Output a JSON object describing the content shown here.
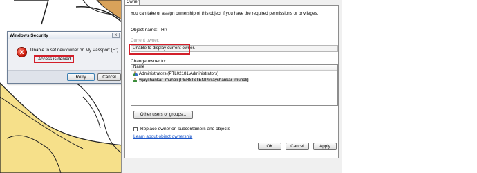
{
  "security_dialog": {
    "title": "Windows Security",
    "close_glyph": "x",
    "error_icon_glyph": "x",
    "message": "Unable to set new owner on My Passport (H:).",
    "detail": "Access is denied.",
    "retry_label": "Retry",
    "cancel_label": "Cancel",
    "icon": "error-icon"
  },
  "owner_dialog": {
    "tab_label": "Owner",
    "intro": "You can take or assign ownership of this object if you have the required permissions or privileges.",
    "object_name_label": "Object name:",
    "object_name_value": "H:\\",
    "current_owner_label": "Current owner:",
    "current_owner_value": "Unable to display current owner.",
    "change_owner_label": "Change owner to:",
    "list_header": "Name",
    "owners": [
      {
        "label": "Administrators (PTL02181\\Administrators)",
        "icon": "group-icon"
      },
      {
        "label": "vijayshankar_munoli (PERSISTENT\\vijayshankar_munoli)",
        "icon": "user-icon",
        "selected": true
      }
    ],
    "other_users_label": "Other users or groups...",
    "replace_label": "Replace owner on subcontainers and objects",
    "replace_checked": false,
    "learn_link": "Learn about object ownership",
    "ok_label": "OK",
    "cancel_label": "Cancel",
    "apply_label": "Apply"
  },
  "colors": {
    "highlight_red": "#d31f2a",
    "link_blue": "#1a55c8"
  }
}
